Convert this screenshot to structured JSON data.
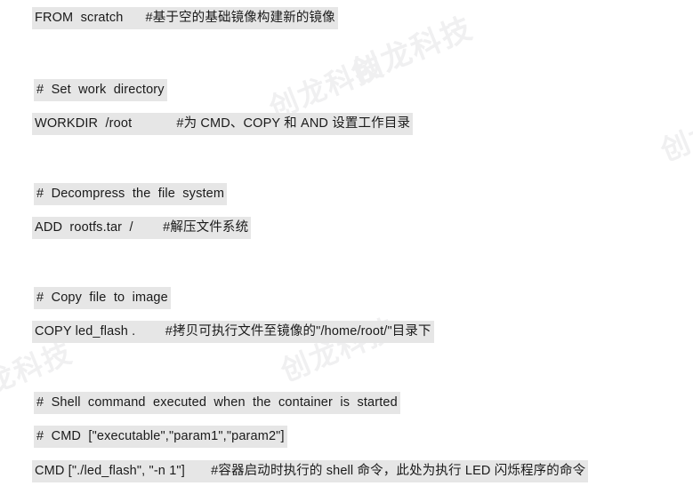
{
  "document": {
    "type": "dockerfile-listing",
    "background_color": "#ffffff",
    "highlight_color": "#e6e6e6",
    "text_color": "#1a1a1a",
    "watermark_color": "#f0f0f1",
    "watermark_text": "创龙科技"
  },
  "lines": [
    {
      "id": "from-scratch",
      "text": "FROM  scratch      #基于空的基础镜像构建新的镜像"
    },
    {
      "id": "comment-set-workdir",
      "text": "#  Set  work  directory"
    },
    {
      "id": "workdir-root",
      "text": "WORKDIR  /root            #为 CMD、COPY 和 AND 设置工作目录"
    },
    {
      "id": "comment-decompress",
      "text": "#  Decompress  the  file  system"
    },
    {
      "id": "add-rootfs",
      "text": "ADD  rootfs.tar  /        #解压文件系统"
    },
    {
      "id": "comment-copy-file",
      "text": "#  Copy  file  to  image"
    },
    {
      "id": "copy-led-flash",
      "text": "COPY led_flash .        #拷贝可执行文件至镜像的\"/home/root/\"目录下"
    },
    {
      "id": "comment-shell-cmd",
      "text": "#  Shell  command  executed  when  the  container  is  started"
    },
    {
      "id": "comment-cmd-syntax",
      "text": "#  CMD  [\"executable\",\"param1\",\"param2\"]"
    },
    {
      "id": "cmd-led-flash",
      "text": "CMD [\"./led_flash\", \"-n 1\"]       #容器启动时执行的 shell 命令，此处为执行 LED 闪烁程序的命令"
    }
  ],
  "watermarks": [
    {
      "id": "wm-top-right",
      "text": "创龙科技"
    },
    {
      "id": "wm-upper-mid",
      "text": "创龙科技"
    },
    {
      "id": "wm-right-edge",
      "text": "创龙"
    },
    {
      "id": "wm-center",
      "text": "创龙科技"
    },
    {
      "id": "wm-left-edge",
      "text": "龙科技"
    }
  ]
}
